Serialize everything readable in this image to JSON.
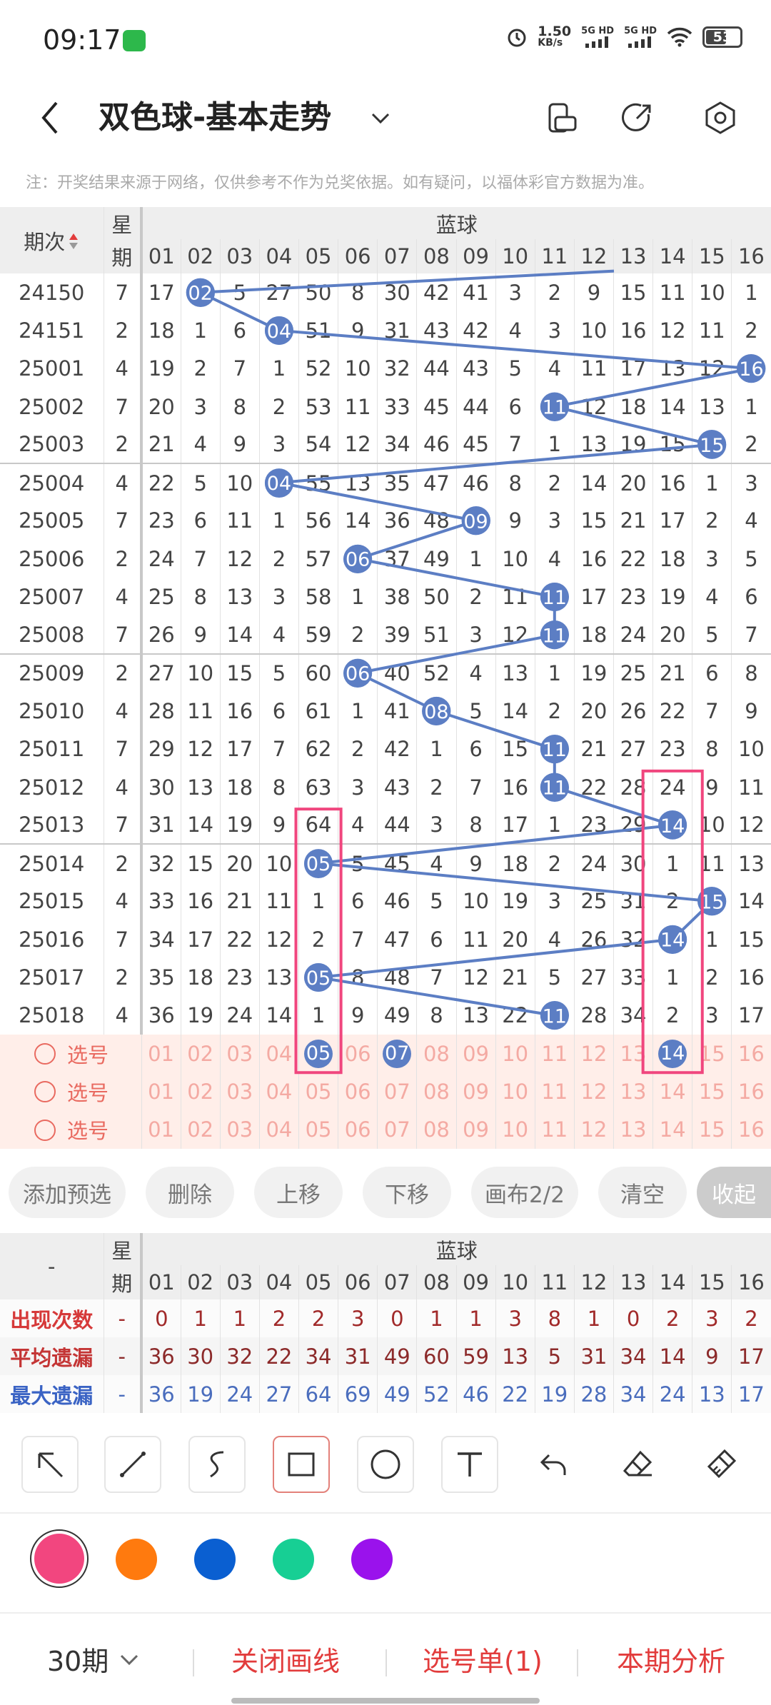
{
  "status": {
    "time": "09:17",
    "speed_val": "1.50",
    "speed_unit": "KB/s",
    "net1": "5G HD",
    "net2": "5G HD",
    "battery": "53"
  },
  "header": {
    "title": "双色球-基本走势"
  },
  "notice": "注：开奖结果来源于网络，仅供参考不作为兑奖依据。如有疑问，以福体彩官方数据为准。",
  "grid": {
    "period_label": "期次",
    "week_top": "星",
    "week_bottom": "期",
    "blue_label": "蓝球",
    "cols": [
      "01",
      "02",
      "03",
      "04",
      "05",
      "06",
      "07",
      "08",
      "09",
      "10",
      "11",
      "12",
      "13",
      "14",
      "15",
      "16"
    ],
    "rows": [
      {
        "p": "24150",
        "w": "7",
        "v": [
          17,
          "02",
          5,
          27,
          50,
          8,
          30,
          42,
          41,
          3,
          2,
          9,
          15,
          11,
          10,
          1
        ],
        "b": 2
      },
      {
        "p": "24151",
        "w": "2",
        "v": [
          18,
          1,
          6,
          "04",
          51,
          9,
          31,
          43,
          42,
          4,
          3,
          10,
          16,
          12,
          11,
          2
        ],
        "b": 4
      },
      {
        "p": "25001",
        "w": "4",
        "v": [
          19,
          2,
          7,
          1,
          52,
          10,
          32,
          44,
          43,
          5,
          4,
          11,
          17,
          13,
          12,
          "16"
        ],
        "b": 16
      },
      {
        "p": "25002",
        "w": "7",
        "v": [
          20,
          3,
          8,
          2,
          53,
          11,
          33,
          45,
          44,
          6,
          "11",
          12,
          18,
          14,
          13,
          1
        ],
        "b": 11
      },
      {
        "p": "25003",
        "w": "2",
        "v": [
          21,
          4,
          9,
          3,
          54,
          12,
          34,
          46,
          45,
          7,
          1,
          13,
          19,
          15,
          "15",
          2
        ],
        "b": 15
      },
      {
        "p": "25004",
        "w": "4",
        "v": [
          22,
          5,
          10,
          "04",
          55,
          13,
          35,
          47,
          46,
          8,
          2,
          14,
          20,
          16,
          1,
          3
        ],
        "b": 4
      },
      {
        "p": "25005",
        "w": "7",
        "v": [
          23,
          6,
          11,
          1,
          56,
          14,
          36,
          48,
          "09",
          9,
          3,
          15,
          21,
          17,
          2,
          4
        ],
        "b": 9
      },
      {
        "p": "25006",
        "w": "2",
        "v": [
          24,
          7,
          12,
          2,
          57,
          "06",
          37,
          49,
          1,
          10,
          4,
          16,
          22,
          18,
          3,
          5
        ],
        "b": 6
      },
      {
        "p": "25007",
        "w": "4",
        "v": [
          25,
          8,
          13,
          3,
          58,
          1,
          38,
          50,
          2,
          11,
          "11",
          17,
          23,
          19,
          4,
          6
        ],
        "b": 11
      },
      {
        "p": "25008",
        "w": "7",
        "v": [
          26,
          9,
          14,
          4,
          59,
          2,
          39,
          51,
          3,
          12,
          "11",
          18,
          24,
          20,
          5,
          7
        ],
        "b": 11
      },
      {
        "p": "25009",
        "w": "2",
        "v": [
          27,
          10,
          15,
          5,
          60,
          "06",
          40,
          52,
          4,
          13,
          1,
          19,
          25,
          21,
          6,
          8
        ],
        "b": 6
      },
      {
        "p": "25010",
        "w": "4",
        "v": [
          28,
          11,
          16,
          6,
          61,
          1,
          41,
          "08",
          5,
          14,
          2,
          20,
          26,
          22,
          7,
          9
        ],
        "b": 8
      },
      {
        "p": "25011",
        "w": "7",
        "v": [
          29,
          12,
          17,
          7,
          62,
          2,
          42,
          1,
          6,
          15,
          "11",
          21,
          27,
          23,
          8,
          10
        ],
        "b": 11
      },
      {
        "p": "25012",
        "w": "4",
        "v": [
          30,
          13,
          18,
          8,
          63,
          3,
          43,
          2,
          7,
          16,
          "11",
          22,
          28,
          24,
          9,
          11
        ],
        "b": 11
      },
      {
        "p": "25013",
        "w": "7",
        "v": [
          31,
          14,
          19,
          9,
          64,
          4,
          44,
          3,
          8,
          17,
          1,
          23,
          29,
          "14",
          10,
          12
        ],
        "b": 14
      },
      {
        "p": "25014",
        "w": "2",
        "v": [
          32,
          15,
          20,
          10,
          "05",
          5,
          45,
          4,
          9,
          18,
          2,
          24,
          30,
          1,
          11,
          13
        ],
        "b": 5
      },
      {
        "p": "25015",
        "w": "4",
        "v": [
          33,
          16,
          21,
          11,
          1,
          6,
          46,
          5,
          10,
          19,
          3,
          25,
          31,
          2,
          "15",
          14
        ],
        "b": 15
      },
      {
        "p": "25016",
        "w": "7",
        "v": [
          34,
          17,
          22,
          12,
          2,
          7,
          47,
          6,
          11,
          20,
          4,
          26,
          32,
          "14",
          1,
          15
        ],
        "b": 14
      },
      {
        "p": "25017",
        "w": "2",
        "v": [
          35,
          18,
          23,
          13,
          "05",
          8,
          48,
          7,
          12,
          21,
          5,
          27,
          33,
          1,
          2,
          16
        ],
        "b": 5
      },
      {
        "p": "25018",
        "w": "4",
        "v": [
          36,
          19,
          24,
          14,
          1,
          9,
          49,
          8,
          13,
          22,
          "11",
          28,
          34,
          2,
          3,
          17
        ],
        "b": 11
      }
    ],
    "pick_label": "选号",
    "pick_rows": [
      {
        "sel": [
          "05",
          "07",
          "14"
        ]
      },
      {
        "sel": []
      },
      {
        "sel": []
      }
    ]
  },
  "buttons": [
    "添加预选",
    "删除",
    "上移",
    "下移",
    "画布2/2",
    "清空",
    "收起"
  ],
  "stats": {
    "corner": "-",
    "week_top": "星",
    "week_bottom": "期",
    "blue_label": "蓝球",
    "rows": [
      {
        "label": "出现次数",
        "w": "-",
        "v": [
          0,
          1,
          1,
          2,
          2,
          3,
          0,
          1,
          1,
          3,
          8,
          1,
          0,
          2,
          3,
          2
        ]
      },
      {
        "label": "平均遗漏",
        "w": "-",
        "v": [
          36,
          30,
          32,
          22,
          34,
          31,
          49,
          60,
          59,
          13,
          5,
          31,
          34,
          14,
          9,
          17
        ]
      },
      {
        "label": "最大遗漏",
        "w": "-",
        "v": [
          36,
          19,
          24,
          27,
          64,
          69,
          49,
          52,
          46,
          22,
          19,
          28,
          34,
          24,
          13,
          17
        ]
      }
    ]
  },
  "tools": [
    "arrow-tool",
    "line-tool",
    "freehand-tool",
    "rectangle-tool",
    "circle-tool",
    "text-tool",
    "undo-tool",
    "eraser-tool",
    "clear-brush-tool"
  ],
  "colors": [
    "#f2467f",
    "#ff7a0e",
    "#0a5fd1",
    "#17cf94",
    "#9a12ec"
  ],
  "bottom": {
    "period": "30期",
    "close_draw": "关闭画线",
    "pick_list": "选号单(1)",
    "analysis": "本期分析"
  }
}
